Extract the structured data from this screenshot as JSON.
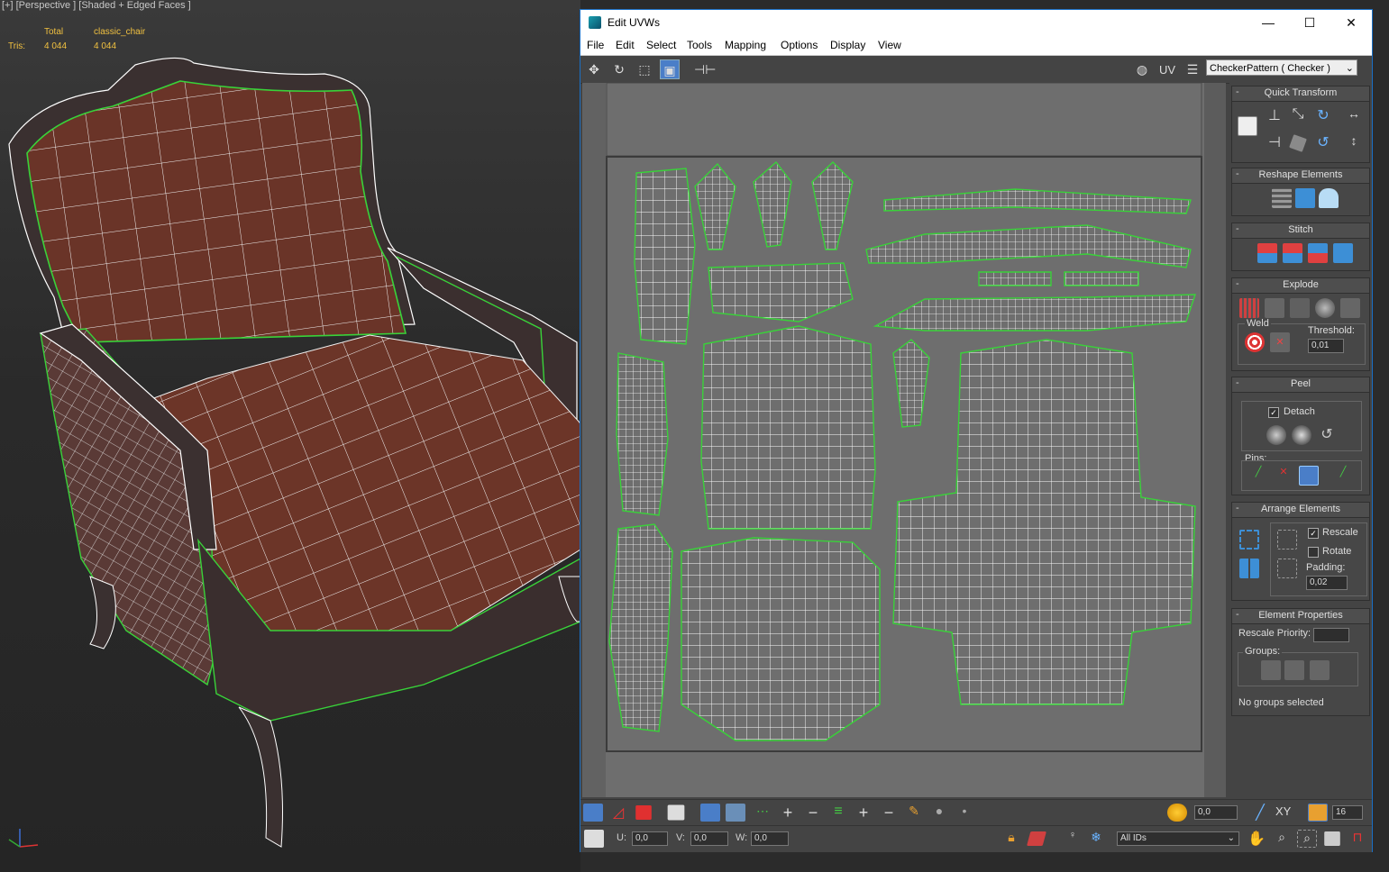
{
  "viewport": {
    "label": "[+] [Perspective ] [Shaded + Edged Faces ]",
    "stats": {
      "col_total": "Total",
      "col_object": "classic_chair",
      "row_label": "Tris:",
      "total_tris": "4 044",
      "object_tris": "4 044"
    }
  },
  "window": {
    "title": "Edit UVWs",
    "controls": {
      "minimize": "—",
      "maximize": "☐",
      "close": "✕"
    },
    "menu": [
      "File",
      "Edit",
      "Select",
      "Tools",
      "Mapping",
      "Options",
      "Display",
      "View"
    ],
    "uv_label": "UV",
    "texture_select": "CheckerPattern  ( Checker )"
  },
  "panel": {
    "quick_transform": {
      "title": "Quick Transform"
    },
    "reshape": {
      "title": "Reshape Elements"
    },
    "stitch": {
      "title": "Stitch"
    },
    "explode": {
      "title": "Explode",
      "weld_label": "Weld",
      "threshold_label": "Threshold:",
      "threshold_value": "0,01"
    },
    "peel": {
      "title": "Peel",
      "detach_label": "Detach",
      "detach_checked": true,
      "pins_label": "Pins:"
    },
    "arrange": {
      "title": "Arrange Elements",
      "rescale_label": "Rescale",
      "rescale_checked": true,
      "rotate_label": "Rotate",
      "rotate_checked": false,
      "padding_label": "Padding:",
      "padding_value": "0,02"
    },
    "element_props": {
      "title": "Element Properties",
      "rescale_priority_label": "Rescale Priority:",
      "groups_label": "Groups:",
      "no_groups": "No groups selected"
    }
  },
  "bottom": {
    "soft_value": "0,0",
    "xy_label": "XY",
    "grid_value": "16",
    "u_label": "U:",
    "u_value": "0,0",
    "v_label": "V:",
    "v_value": "0,0",
    "w_label": "W:",
    "w_value": "0,0",
    "id_select": "All IDs"
  },
  "colors": {
    "accent": "#4a7ec8",
    "seam": "#39d239",
    "wire": "#ffffff",
    "uv_bg": "#6e6e6e",
    "leather": "#6a3428"
  }
}
